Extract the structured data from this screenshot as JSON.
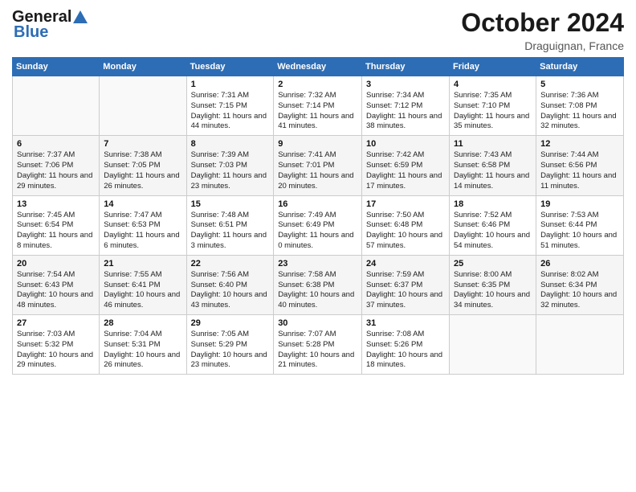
{
  "header": {
    "logo_general": "General",
    "logo_blue": "Blue",
    "month_title": "October 2024",
    "location": "Draguignan, France"
  },
  "weekdays": [
    "Sunday",
    "Monday",
    "Tuesday",
    "Wednesday",
    "Thursday",
    "Friday",
    "Saturday"
  ],
  "weeks": [
    [
      {
        "day": "",
        "sunrise": "",
        "sunset": "",
        "daylight": ""
      },
      {
        "day": "",
        "sunrise": "",
        "sunset": "",
        "daylight": ""
      },
      {
        "day": "1",
        "sunrise": "Sunrise: 7:31 AM",
        "sunset": "Sunset: 7:15 PM",
        "daylight": "Daylight: 11 hours and 44 minutes."
      },
      {
        "day": "2",
        "sunrise": "Sunrise: 7:32 AM",
        "sunset": "Sunset: 7:14 PM",
        "daylight": "Daylight: 11 hours and 41 minutes."
      },
      {
        "day": "3",
        "sunrise": "Sunrise: 7:34 AM",
        "sunset": "Sunset: 7:12 PM",
        "daylight": "Daylight: 11 hours and 38 minutes."
      },
      {
        "day": "4",
        "sunrise": "Sunrise: 7:35 AM",
        "sunset": "Sunset: 7:10 PM",
        "daylight": "Daylight: 11 hours and 35 minutes."
      },
      {
        "day": "5",
        "sunrise": "Sunrise: 7:36 AM",
        "sunset": "Sunset: 7:08 PM",
        "daylight": "Daylight: 11 hours and 32 minutes."
      }
    ],
    [
      {
        "day": "6",
        "sunrise": "Sunrise: 7:37 AM",
        "sunset": "Sunset: 7:06 PM",
        "daylight": "Daylight: 11 hours and 29 minutes."
      },
      {
        "day": "7",
        "sunrise": "Sunrise: 7:38 AM",
        "sunset": "Sunset: 7:05 PM",
        "daylight": "Daylight: 11 hours and 26 minutes."
      },
      {
        "day": "8",
        "sunrise": "Sunrise: 7:39 AM",
        "sunset": "Sunset: 7:03 PM",
        "daylight": "Daylight: 11 hours and 23 minutes."
      },
      {
        "day": "9",
        "sunrise": "Sunrise: 7:41 AM",
        "sunset": "Sunset: 7:01 PM",
        "daylight": "Daylight: 11 hours and 20 minutes."
      },
      {
        "day": "10",
        "sunrise": "Sunrise: 7:42 AM",
        "sunset": "Sunset: 6:59 PM",
        "daylight": "Daylight: 11 hours and 17 minutes."
      },
      {
        "day": "11",
        "sunrise": "Sunrise: 7:43 AM",
        "sunset": "Sunset: 6:58 PM",
        "daylight": "Daylight: 11 hours and 14 minutes."
      },
      {
        "day": "12",
        "sunrise": "Sunrise: 7:44 AM",
        "sunset": "Sunset: 6:56 PM",
        "daylight": "Daylight: 11 hours and 11 minutes."
      }
    ],
    [
      {
        "day": "13",
        "sunrise": "Sunrise: 7:45 AM",
        "sunset": "Sunset: 6:54 PM",
        "daylight": "Daylight: 11 hours and 8 minutes."
      },
      {
        "day": "14",
        "sunrise": "Sunrise: 7:47 AM",
        "sunset": "Sunset: 6:53 PM",
        "daylight": "Daylight: 11 hours and 6 minutes."
      },
      {
        "day": "15",
        "sunrise": "Sunrise: 7:48 AM",
        "sunset": "Sunset: 6:51 PM",
        "daylight": "Daylight: 11 hours and 3 minutes."
      },
      {
        "day": "16",
        "sunrise": "Sunrise: 7:49 AM",
        "sunset": "Sunset: 6:49 PM",
        "daylight": "Daylight: 11 hours and 0 minutes."
      },
      {
        "day": "17",
        "sunrise": "Sunrise: 7:50 AM",
        "sunset": "Sunset: 6:48 PM",
        "daylight": "Daylight: 10 hours and 57 minutes."
      },
      {
        "day": "18",
        "sunrise": "Sunrise: 7:52 AM",
        "sunset": "Sunset: 6:46 PM",
        "daylight": "Daylight: 10 hours and 54 minutes."
      },
      {
        "day": "19",
        "sunrise": "Sunrise: 7:53 AM",
        "sunset": "Sunset: 6:44 PM",
        "daylight": "Daylight: 10 hours and 51 minutes."
      }
    ],
    [
      {
        "day": "20",
        "sunrise": "Sunrise: 7:54 AM",
        "sunset": "Sunset: 6:43 PM",
        "daylight": "Daylight: 10 hours and 48 minutes."
      },
      {
        "day": "21",
        "sunrise": "Sunrise: 7:55 AM",
        "sunset": "Sunset: 6:41 PM",
        "daylight": "Daylight: 10 hours and 46 minutes."
      },
      {
        "day": "22",
        "sunrise": "Sunrise: 7:56 AM",
        "sunset": "Sunset: 6:40 PM",
        "daylight": "Daylight: 10 hours and 43 minutes."
      },
      {
        "day": "23",
        "sunrise": "Sunrise: 7:58 AM",
        "sunset": "Sunset: 6:38 PM",
        "daylight": "Daylight: 10 hours and 40 minutes."
      },
      {
        "day": "24",
        "sunrise": "Sunrise: 7:59 AM",
        "sunset": "Sunset: 6:37 PM",
        "daylight": "Daylight: 10 hours and 37 minutes."
      },
      {
        "day": "25",
        "sunrise": "Sunrise: 8:00 AM",
        "sunset": "Sunset: 6:35 PM",
        "daylight": "Daylight: 10 hours and 34 minutes."
      },
      {
        "day": "26",
        "sunrise": "Sunrise: 8:02 AM",
        "sunset": "Sunset: 6:34 PM",
        "daylight": "Daylight: 10 hours and 32 minutes."
      }
    ],
    [
      {
        "day": "27",
        "sunrise": "Sunrise: 7:03 AM",
        "sunset": "Sunset: 5:32 PM",
        "daylight": "Daylight: 10 hours and 29 minutes."
      },
      {
        "day": "28",
        "sunrise": "Sunrise: 7:04 AM",
        "sunset": "Sunset: 5:31 PM",
        "daylight": "Daylight: 10 hours and 26 minutes."
      },
      {
        "day": "29",
        "sunrise": "Sunrise: 7:05 AM",
        "sunset": "Sunset: 5:29 PM",
        "daylight": "Daylight: 10 hours and 23 minutes."
      },
      {
        "day": "30",
        "sunrise": "Sunrise: 7:07 AM",
        "sunset": "Sunset: 5:28 PM",
        "daylight": "Daylight: 10 hours and 21 minutes."
      },
      {
        "day": "31",
        "sunrise": "Sunrise: 7:08 AM",
        "sunset": "Sunset: 5:26 PM",
        "daylight": "Daylight: 10 hours and 18 minutes."
      },
      {
        "day": "",
        "sunrise": "",
        "sunset": "",
        "daylight": ""
      },
      {
        "day": "",
        "sunrise": "",
        "sunset": "",
        "daylight": ""
      }
    ]
  ]
}
